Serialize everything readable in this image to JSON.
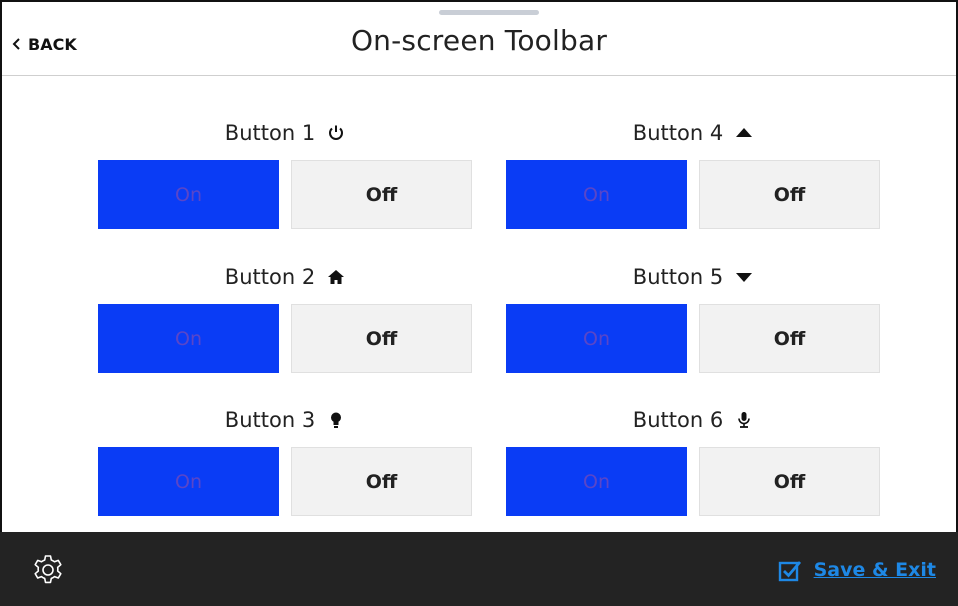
{
  "header": {
    "back_label": "BACK",
    "title": "On-screen Toolbar"
  },
  "groups": [
    {
      "label": "Button 1",
      "icon": "power-icon",
      "on_label": "On",
      "off_label": "Off",
      "state": "on"
    },
    {
      "label": "Button 2",
      "icon": "home-icon",
      "on_label": "On",
      "off_label": "Off",
      "state": "on"
    },
    {
      "label": "Button 3",
      "icon": "lightbulb-icon",
      "on_label": "On",
      "off_label": "Off",
      "state": "on"
    },
    {
      "label": "Button 4",
      "icon": "triangle-up-icon",
      "on_label": "On",
      "off_label": "Off",
      "state": "on"
    },
    {
      "label": "Button 5",
      "icon": "triangle-down-icon",
      "on_label": "On",
      "off_label": "Off",
      "state": "on"
    },
    {
      "label": "Button 6",
      "icon": "microphone-icon",
      "on_label": "On",
      "off_label": "Off",
      "state": "on"
    }
  ],
  "footer": {
    "settings_icon": "gear-icon",
    "save_label": "Save & Exit"
  },
  "colors": {
    "on_bg": "#0a3cf5",
    "off_bg": "#f2f2f2",
    "footer_bg": "#232323",
    "accent": "#1e88e5"
  }
}
